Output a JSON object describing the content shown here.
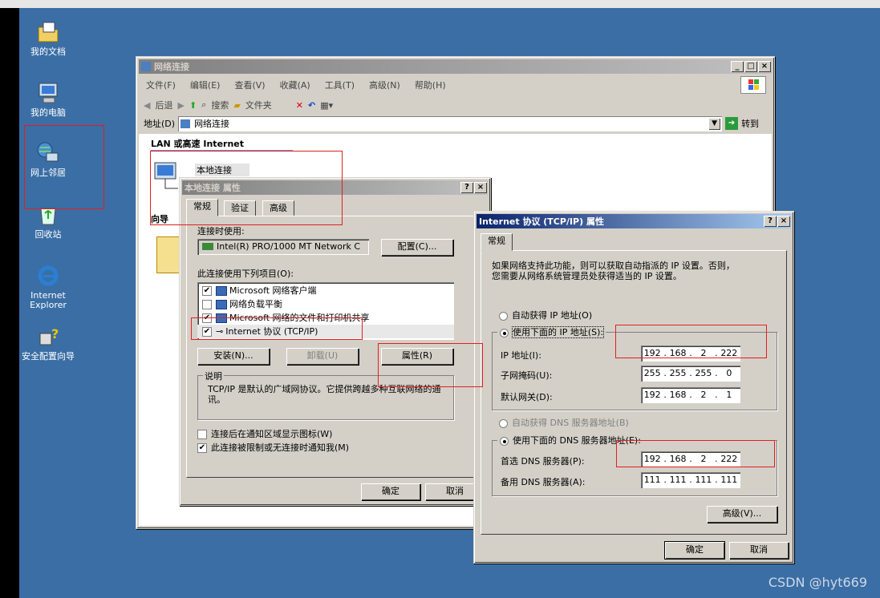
{
  "desktop": {
    "icons": [
      {
        "label": "我的文档"
      },
      {
        "label": "我的电脑"
      },
      {
        "label": "网上邻居"
      },
      {
        "label": "回收站"
      },
      {
        "label_line1": "Internet",
        "label_line2": "Explorer"
      },
      {
        "label": "安全配置向导"
      }
    ],
    "watermark": "CSDN @hyt669"
  },
  "explorer": {
    "title": "网络连接",
    "menu": [
      "文件(F)",
      "编辑(E)",
      "查看(V)",
      "收藏(A)",
      "工具(T)",
      "高级(N)",
      "帮助(H)"
    ],
    "toolbar": {
      "back": "后退",
      "search": "搜索",
      "folders": "文件夹"
    },
    "address_label": "地址(D)",
    "address_value": "网络连接",
    "go_label": "转到",
    "section_header": "LAN 或高速 Internet",
    "connection_name": "本地连接",
    "wizard_header": "向导"
  },
  "local_props": {
    "title": "本地连接 属性",
    "tabs": [
      "常规",
      "验证",
      "高级"
    ],
    "connect_using_label": "连接时使用:",
    "adapter": "Intel(R) PRO/1000 MT Network C",
    "configure_btn": "配置(C)...",
    "items_label": "此连接使用下列项目(O):",
    "items": [
      {
        "label": "Microsoft 网络客户端",
        "checked": "✔"
      },
      {
        "label": "网络负载平衡",
        "checked": ""
      },
      {
        "label": "Microsoft 网络的文件和打印机共享",
        "checked": "✔"
      },
      {
        "label": "Internet 协议 (TCP/IP)",
        "checked": "✔"
      }
    ],
    "install_btn": "安装(N)...",
    "uninstall_btn": "卸载(U)",
    "properties_btn": "属性(R)",
    "desc_title": "说明",
    "desc_text": "TCP/IP 是默认的广域网协议。它提供跨越多种互联网络的通讯。",
    "show_icon_label": "连接后在通知区域显示图标(W)",
    "notify_label": "此连接被限制或无连接时通知我(M)",
    "ok_btn": "确定",
    "cancel_btn": "取消"
  },
  "tcpip": {
    "title": "Internet 协议 (TCP/IP) 属性",
    "tab": "常规",
    "intro_line1": "如果网络支持此功能，则可以获取自动指派的 IP 设置。否则，",
    "intro_line2": "您需要从网络系统管理员处获得适当的 IP 设置。",
    "auto_ip": "自动获得 IP 地址(O)",
    "manual_ip": "使用下面的 IP 地址(S):",
    "ip_label": "IP 地址(I):",
    "ip": [
      "192",
      "168",
      "2",
      "222"
    ],
    "mask_label": "子网掩码(U):",
    "mask": [
      "255",
      "255",
      "255",
      "0"
    ],
    "gw_label": "默认网关(D):",
    "gw": [
      "192",
      "168",
      "2",
      "1"
    ],
    "auto_dns": "自动获得 DNS 服务器地址(B)",
    "manual_dns": "使用下面的 DNS 服务器地址(E):",
    "dns1_label": "首选 DNS 服务器(P):",
    "dns1": [
      "192",
      "168",
      "2",
      "222"
    ],
    "dns2_label": "备用 DNS 服务器(A):",
    "dns2": [
      "111",
      "111",
      "111",
      "111"
    ],
    "advanced_btn": "高级(V)...",
    "ok_btn": "确定",
    "cancel_btn": "取消"
  }
}
